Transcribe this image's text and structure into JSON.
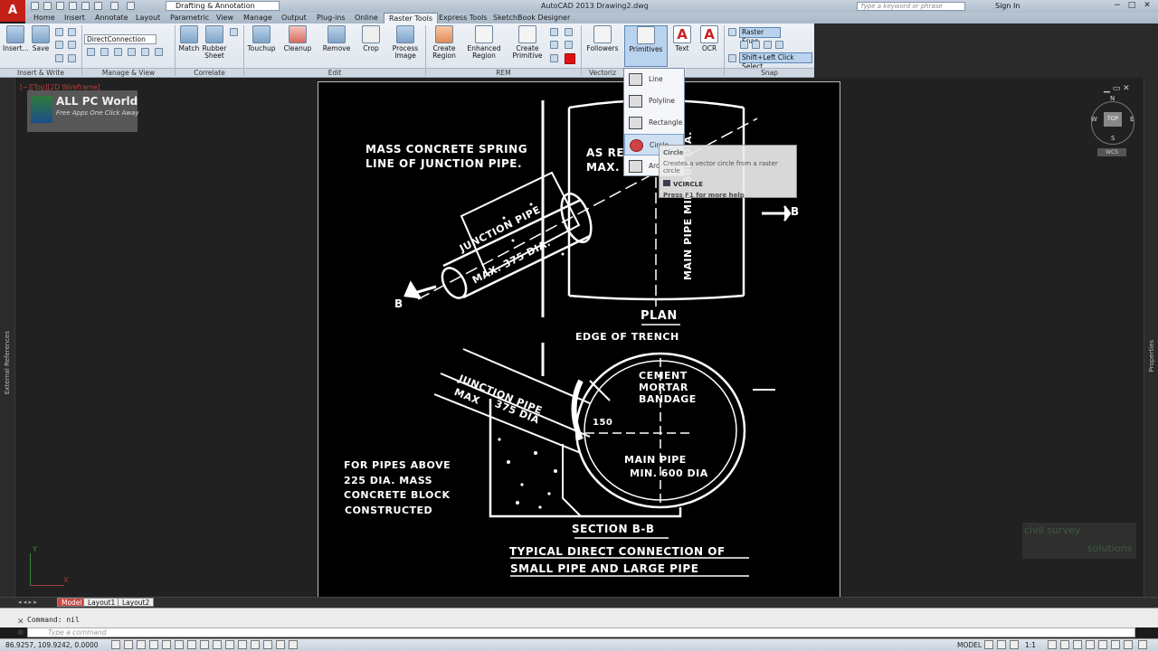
{
  "titlebar": {
    "app_letter": "A",
    "workspace": "Drafting & Annotation",
    "title": "AutoCAD 2013    Drawing2.dwg",
    "search_placeholder": "Type a keyword or phrase",
    "sign_in": "Sign In",
    "minimize": "−",
    "maximize": "□",
    "close": "✕"
  },
  "tabs": [
    "Home",
    "Insert",
    "Annotate",
    "Layout",
    "Parametric",
    "View",
    "Manage",
    "Output",
    "Plug-ins",
    "Online",
    "Raster Tools",
    "Express Tools",
    "SketchBook Designer"
  ],
  "active_tab": "Raster Tools",
  "ribbon": {
    "insert": "Insert...",
    "save": "Save",
    "direct_connection": "DirectConnection",
    "match": "Match",
    "rubber_sheet": "Rubber Sheet",
    "touchup": "Touchup",
    "cleanup": "Cleanup",
    "remove": "Remove",
    "crop": "Crop",
    "process_image": "Process Image",
    "create_region": "Create Region",
    "enhanced_region": "Enhanced Region",
    "create_primitive": "Create Primitive",
    "followers": "Followers",
    "primitives": "Primitives",
    "text": "Text",
    "ocr": "OCR",
    "raster_snap": "Raster Snap",
    "shift_left_click": "Shift+Left Click Select",
    "groups": {
      "insert_write": "Insert & Write",
      "manage_view": "Manage & View",
      "correlate": "Correlate",
      "edit": "Edit",
      "rem": "REM",
      "vectorize": "Vectoriz",
      "snap": "Snap"
    }
  },
  "dropdown": {
    "items": [
      "Line",
      "Polyline",
      "Rectangle",
      "Circle",
      "Arc"
    ],
    "highlighted": "Circle"
  },
  "tooltip": {
    "title": "Circle",
    "description": "Creates a vector circle from a raster circle",
    "command": "VCIRCLE",
    "help": "Press F1 for more help"
  },
  "viewport": {
    "label": "[−][Top][2D Wireframe]",
    "logo_title": "ALL PC World",
    "logo_sub": "Free Apps One Click Away",
    "compass": {
      "n": "N",
      "s": "S",
      "e": "E",
      "w": "W",
      "top": "TOP"
    },
    "wcs": "WCS",
    "left_panel": "External References",
    "right_panel": "Properties",
    "watermark_line1": "civil survey",
    "watermark_line2": "solutions"
  },
  "drawing": {
    "mass_concrete": "MASS CONCRETE SPRING",
    "junction_line": "LINE OF JUNCTION PIPE.",
    "as_re": "AS RE",
    "max6": "MAX. 6",
    "junction_pipe": "JUNCTION PIPE",
    "max375": "MAX. 375 DIA.",
    "main_pipe_min": "MAIN PIPE MIN. 600 DIA.",
    "b_left": "B",
    "b_right": "B",
    "plan": "PLAN",
    "edge_of_trench": "EDGE OF TRENCH",
    "cement": "CEMENT",
    "mortar": "MORTAR",
    "bandage": "BANDAGE",
    "junction_pipe2": "JUNCTION PIPE",
    "max2": "MAX",
    "dia375": "375 DIA",
    "d150": "150",
    "main_pipe": "MAIN PIPE",
    "min600": "MIN. 600 DIA",
    "for_pipes": "FOR PIPES ABOVE",
    "dia225": "225 DIA. MASS",
    "concrete_block": "CONCRETE BLOCK",
    "constructed": "CONSTRUCTED",
    "section": "SECTION B-B",
    "caption1": "TYPICAL DIRECT CONNECTION OF",
    "caption2": "SMALL PIPE AND LARGE PIPE"
  },
  "layout_tabs": [
    "Model",
    "Layout1",
    "Layout2"
  ],
  "command": {
    "history": "Command: nil",
    "placeholder": "Type a command"
  },
  "status": {
    "coords": "86.9257, 109.9242, 0.0000",
    "model": "MODEL",
    "scale": "1:1"
  }
}
